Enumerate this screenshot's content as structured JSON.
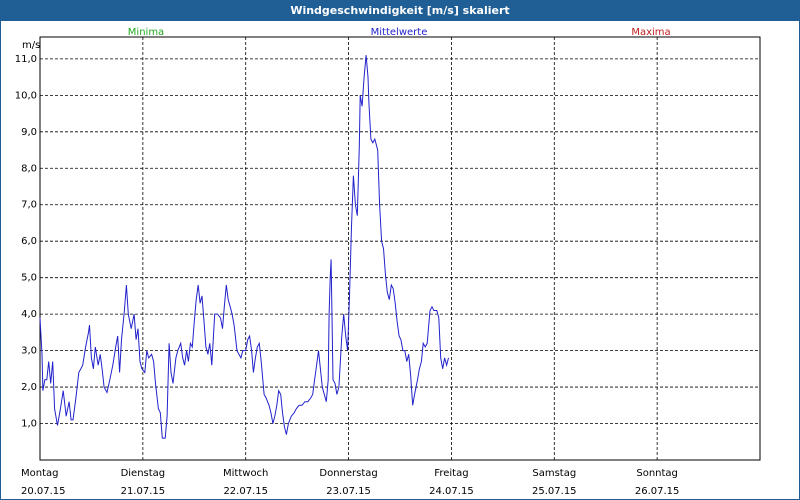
{
  "chart_data": {
    "type": "line",
    "title": "Windgeschwindigkeit [m/s] skaliert",
    "ylabel": "m/s",
    "xlabel": "",
    "ylim": [
      0,
      11.6
    ],
    "xlim": [
      0,
      7
    ],
    "y_ticks": [
      "1,0",
      "2,0",
      "3,0",
      "4,0",
      "5,0",
      "6,0",
      "7,0",
      "8,0",
      "9,0",
      "10,0",
      "11,0"
    ],
    "y_tick_values": [
      1,
      2,
      3,
      4,
      5,
      6,
      7,
      8,
      9,
      10,
      11
    ],
    "grid": true,
    "legend": [
      {
        "name": "Minima",
        "color": "#22a822",
        "position": "top-left"
      },
      {
        "name": "Mittelwerte",
        "color": "#2222cc",
        "position": "top-center"
      },
      {
        "name": "Maxima",
        "color": "#c02020",
        "position": "top-right"
      }
    ],
    "days": [
      {
        "weekday": "Montag",
        "date": "20.07.15"
      },
      {
        "weekday": "Dienstag",
        "date": "21.07.15"
      },
      {
        "weekday": "Mittwoch",
        "date": "22.07.15"
      },
      {
        "weekday": "Donnerstag",
        "date": "23.07.15"
      },
      {
        "weekday": "Freitag",
        "date": "24.07.15"
      },
      {
        "weekday": "Samstag",
        "date": "25.07.15"
      },
      {
        "weekday": "Sonntag",
        "date": "26.07.15"
      }
    ],
    "series": [
      {
        "name": "Mittelwerte",
        "color": "#2222cc",
        "x_unit": "days",
        "points": [
          [
            0.0,
            3.9
          ],
          [
            0.019,
            2.9
          ],
          [
            0.028,
            1.9
          ],
          [
            0.047,
            2.2
          ],
          [
            0.066,
            2.2
          ],
          [
            0.085,
            2.7
          ],
          [
            0.104,
            2.1
          ],
          [
            0.123,
            2.7
          ],
          [
            0.142,
            1.4
          ],
          [
            0.17,
            0.95
          ],
          [
            0.198,
            1.4
          ],
          [
            0.226,
            1.9
          ],
          [
            0.255,
            1.2
          ],
          [
            0.283,
            1.6
          ],
          [
            0.302,
            1.1
          ],
          [
            0.321,
            1.1
          ],
          [
            0.349,
            1.7
          ],
          [
            0.377,
            2.4
          ],
          [
            0.415,
            2.6
          ],
          [
            0.443,
            3.1
          ],
          [
            0.472,
            3.5
          ],
          [
            0.481,
            3.7
          ],
          [
            0.5,
            2.8
          ],
          [
            0.519,
            2.5
          ],
          [
            0.538,
            3.1
          ],
          [
            0.566,
            2.6
          ],
          [
            0.585,
            2.9
          ],
          [
            0.604,
            2.5
          ],
          [
            0.623,
            2.0
          ],
          [
            0.651,
            1.85
          ],
          [
            0.679,
            2.2
          ],
          [
            0.708,
            2.6
          ],
          [
            0.736,
            3.1
          ],
          [
            0.755,
            3.4
          ],
          [
            0.774,
            2.4
          ],
          [
            0.792,
            3.3
          ],
          [
            0.821,
            4.1
          ],
          [
            0.84,
            4.8
          ],
          [
            0.858,
            4.0
          ],
          [
            0.887,
            3.6
          ],
          [
            0.915,
            4.0
          ],
          [
            0.934,
            3.3
          ],
          [
            0.953,
            3.6
          ],
          [
            0.972,
            2.7
          ],
          [
            0.991,
            2.5
          ],
          [
            1.019,
            2.4
          ],
          [
            1.038,
            3.0
          ],
          [
            1.057,
            2.8
          ],
          [
            1.085,
            2.9
          ],
          [
            1.104,
            2.7
          ],
          [
            1.123,
            2.1
          ],
          [
            1.151,
            1.4
          ],
          [
            1.17,
            1.3
          ],
          [
            1.189,
            0.6
          ],
          [
            1.217,
            0.6
          ],
          [
            1.236,
            1.2
          ],
          [
            1.255,
            3.2
          ],
          [
            1.274,
            2.4
          ],
          [
            1.293,
            2.1
          ],
          [
            1.321,
            2.8
          ],
          [
            1.34,
            3.0
          ],
          [
            1.368,
            3.2
          ],
          [
            1.387,
            2.8
          ],
          [
            1.406,
            2.6
          ],
          [
            1.425,
            3.0
          ],
          [
            1.443,
            2.7
          ],
          [
            1.462,
            3.2
          ],
          [
            1.481,
            3.1
          ],
          [
            1.5,
            3.8
          ],
          [
            1.519,
            4.4
          ],
          [
            1.538,
            4.8
          ],
          [
            1.557,
            4.3
          ],
          [
            1.575,
            4.5
          ],
          [
            1.594,
            3.8
          ],
          [
            1.613,
            3.1
          ],
          [
            1.632,
            2.9
          ],
          [
            1.651,
            3.2
          ],
          [
            1.67,
            2.6
          ],
          [
            1.698,
            4.0
          ],
          [
            1.726,
            4.0
          ],
          [
            1.755,
            3.9
          ],
          [
            1.774,
            3.6
          ],
          [
            1.792,
            4.2
          ],
          [
            1.811,
            4.8
          ],
          [
            1.83,
            4.4
          ],
          [
            1.849,
            4.2
          ],
          [
            1.868,
            4.0
          ],
          [
            1.887,
            3.7
          ],
          [
            1.915,
            3.0
          ],
          [
            1.934,
            2.9
          ],
          [
            1.953,
            2.8
          ],
          [
            1.972,
            3.0
          ],
          [
            2.0,
            3.0
          ],
          [
            2.019,
            3.3
          ],
          [
            2.038,
            3.4
          ],
          [
            2.057,
            3.0
          ],
          [
            2.075,
            2.4
          ],
          [
            2.094,
            2.8
          ],
          [
            2.113,
            3.1
          ],
          [
            2.132,
            3.2
          ],
          [
            2.151,
            2.7
          ],
          [
            2.179,
            1.8
          ],
          [
            2.198,
            1.7
          ],
          [
            2.226,
            1.5
          ],
          [
            2.245,
            1.3
          ],
          [
            2.264,
            1.0
          ],
          [
            2.283,
            1.2
          ],
          [
            2.302,
            1.5
          ],
          [
            2.321,
            1.9
          ],
          [
            2.34,
            1.8
          ],
          [
            2.358,
            1.3
          ],
          [
            2.377,
            0.9
          ],
          [
            2.396,
            0.7
          ],
          [
            2.415,
            1.0
          ],
          [
            2.443,
            1.2
          ],
          [
            2.472,
            1.3
          ],
          [
            2.491,
            1.4
          ],
          [
            2.519,
            1.5
          ],
          [
            2.547,
            1.5
          ],
          [
            2.575,
            1.6
          ],
          [
            2.604,
            1.6
          ],
          [
            2.632,
            1.7
          ],
          [
            2.651,
            1.8
          ],
          [
            2.67,
            2.2
          ],
          [
            2.689,
            2.6
          ],
          [
            2.708,
            3.0
          ],
          [
            2.726,
            2.5
          ],
          [
            2.745,
            2.0
          ],
          [
            2.764,
            1.8
          ],
          [
            2.783,
            1.6
          ],
          [
            2.802,
            2.2
          ],
          [
            2.811,
            4.0
          ],
          [
            2.821,
            5.0
          ],
          [
            2.83,
            5.5
          ],
          [
            2.849,
            2.2
          ],
          [
            2.868,
            2.1
          ],
          [
            2.887,
            1.8
          ],
          [
            2.906,
            2.0
          ],
          [
            2.934,
            3.4
          ],
          [
            2.953,
            4.0
          ],
          [
            2.972,
            3.4
          ],
          [
            2.991,
            3.0
          ],
          [
            3.009,
            4.5
          ],
          [
            3.028,
            6.4
          ],
          [
            3.047,
            7.8
          ],
          [
            3.066,
            7.0
          ],
          [
            3.085,
            6.7
          ],
          [
            3.104,
            8.6
          ],
          [
            3.113,
            10.0
          ],
          [
            3.132,
            9.7
          ],
          [
            3.151,
            10.5
          ],
          [
            3.17,
            11.1
          ],
          [
            3.189,
            10.5
          ],
          [
            3.198,
            9.8
          ],
          [
            3.217,
            8.8
          ],
          [
            3.236,
            8.7
          ],
          [
            3.255,
            8.8
          ],
          [
            3.283,
            8.5
          ],
          [
            3.302,
            7.0
          ],
          [
            3.321,
            6.0
          ],
          [
            3.34,
            5.8
          ],
          [
            3.358,
            5.1
          ],
          [
            3.377,
            4.6
          ],
          [
            3.396,
            4.4
          ],
          [
            3.415,
            4.8
          ],
          [
            3.434,
            4.7
          ],
          [
            3.453,
            4.3
          ],
          [
            3.472,
            3.8
          ],
          [
            3.491,
            3.4
          ],
          [
            3.509,
            3.3
          ],
          [
            3.528,
            3.0
          ],
          [
            3.547,
            3.0
          ],
          [
            3.566,
            2.7
          ],
          [
            3.585,
            2.9
          ],
          [
            3.604,
            2.3
          ],
          [
            3.623,
            1.5
          ],
          [
            3.642,
            1.8
          ],
          [
            3.67,
            2.2
          ],
          [
            3.689,
            2.5
          ],
          [
            3.708,
            2.7
          ],
          [
            3.726,
            3.2
          ],
          [
            3.745,
            3.1
          ],
          [
            3.764,
            3.2
          ],
          [
            3.792,
            4.1
          ],
          [
            3.811,
            4.2
          ],
          [
            3.83,
            4.1
          ],
          [
            3.858,
            4.1
          ],
          [
            3.877,
            3.9
          ],
          [
            3.896,
            2.8
          ],
          [
            3.915,
            2.5
          ],
          [
            3.934,
            2.8
          ],
          [
            3.953,
            2.6
          ],
          [
            3.972,
            2.8
          ]
        ]
      }
    ]
  }
}
